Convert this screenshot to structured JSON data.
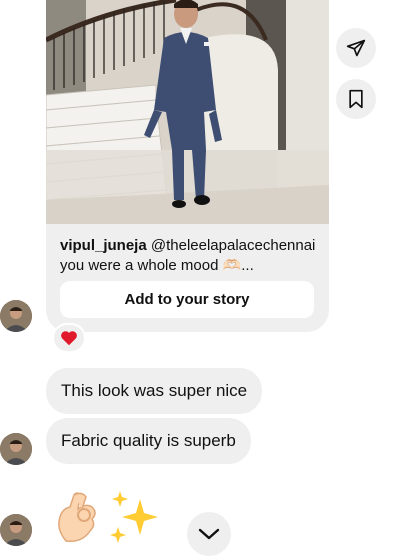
{
  "post": {
    "username": "vipul_juneja",
    "caption": "@theleelapalacechennai you were a whole mood 🫶🏻...",
    "story_button": "Add to your story"
  },
  "side_actions": [
    "share-icon",
    "bookmark-icon"
  ],
  "reaction": "❤️",
  "messages": [
    {
      "text": "This look was super nice"
    },
    {
      "text": "Fabric quality is superb"
    }
  ],
  "emoji_message": "👌🏻✨",
  "scroll_icon": "chevron-down-icon",
  "colors": {
    "bubble": "#efefef",
    "reaction_heart": "#e0192b",
    "suit": "#3e4d72"
  }
}
